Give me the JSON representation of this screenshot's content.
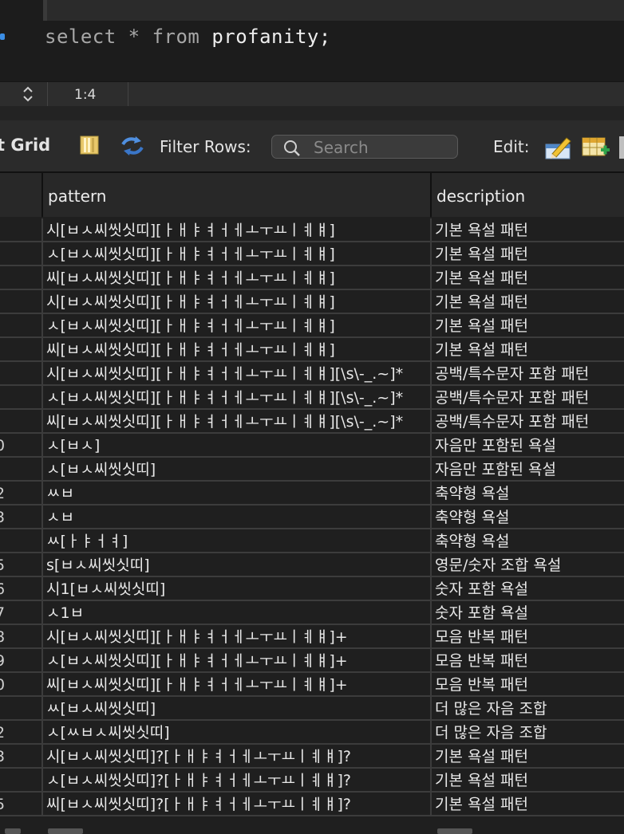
{
  "editor": {
    "query_keyword1": "select",
    "query_star": "*",
    "query_keyword2": "from",
    "query_table": "profanity;"
  },
  "statusbar": {
    "position": "1:4"
  },
  "toolbar": {
    "grid_label": "t Grid",
    "filter_label": "Filter Rows:",
    "search_placeholder": "Search",
    "edit_label": "Edit:"
  },
  "grid": {
    "columns": [
      "pattern",
      "description"
    ],
    "rows": [
      {
        "id": "",
        "pattern": "시[ㅂㅅ씨씻싯띠][ㅏㅐㅑㅕㅓㅔㅗㅜㅛㅣㅖㅒ]",
        "description": "기본 욕설 패턴"
      },
      {
        "id": "",
        "pattern": "ㅅ[ㅂㅅ씨씻싯띠][ㅏㅐㅑㅕㅓㅔㅗㅜㅛㅣㅖㅒ]",
        "description": "기본 욕설 패턴"
      },
      {
        "id": "",
        "pattern": "씨[ㅂㅅ씨씻싯띠][ㅏㅐㅑㅕㅓㅔㅗㅜㅛㅣㅖㅒ]",
        "description": "기본 욕설 패턴"
      },
      {
        "id": "",
        "pattern": "시[ㅂㅅ씨씻싯띠][ㅏㅐㅑㅕㅓㅔㅗㅜㅛㅣㅖㅒ]",
        "description": "기본 욕설 패턴"
      },
      {
        "id": "",
        "pattern": "ㅅ[ㅂㅅ씨씻싯띠][ㅏㅐㅑㅕㅓㅔㅗㅜㅛㅣㅖㅒ]",
        "description": "기본 욕설 패턴"
      },
      {
        "id": "",
        "pattern": "씨[ㅂㅅ씨씻싯띠][ㅏㅐㅑㅕㅓㅔㅗㅜㅛㅣㅖㅒ]",
        "description": "기본 욕설 패턴"
      },
      {
        "id": "",
        "pattern": "시[ㅂㅅ씨씻싯띠][ㅏㅐㅑㅕㅓㅔㅗㅜㅛㅣㅖㅒ][\\s\\-_.~]*",
        "description": "공백/특수문자 포함 패턴"
      },
      {
        "id": "",
        "pattern": "ㅅ[ㅂㅅ씨씻싯띠][ㅏㅐㅑㅕㅓㅔㅗㅜㅛㅣㅖㅒ][\\s\\-_.~]*",
        "description": "공백/특수문자 포함 패턴"
      },
      {
        "id": "",
        "pattern": "씨[ㅂㅅ씨씻싯띠][ㅏㅐㅑㅕㅓㅔㅗㅜㅛㅣㅖㅒ][\\s\\-_.~]*",
        "description": "공백/특수문자 포함 패턴"
      },
      {
        "id": "0",
        "pattern": "ㅅ[ㅂㅅ]",
        "description": "자음만 포함된 욕설"
      },
      {
        "id": "",
        "pattern": "ㅅ[ㅂㅅ씨씻싯띠]",
        "description": "자음만 포함된 욕설"
      },
      {
        "id": "2",
        "pattern": "ㅆㅂ",
        "description": "축약형 욕설"
      },
      {
        "id": "3",
        "pattern": "ㅅㅂ",
        "description": "축약형 욕설"
      },
      {
        "id": "",
        "pattern": "ㅆ[ㅏㅑㅓㅕ]",
        "description": "축약형 욕설"
      },
      {
        "id": "5",
        "pattern": "s[ㅂㅅ씨씻싯띠]",
        "description": "영문/숫자 조합 욕설"
      },
      {
        "id": "6",
        "pattern": "시1[ㅂㅅ씨씻싯띠]",
        "description": "숫자 포함 욕설"
      },
      {
        "id": "7",
        "pattern": "ㅅ1ㅂ",
        "description": "숫자 포함 욕설"
      },
      {
        "id": "8",
        "pattern": "시[ㅂㅅ씨씻싯띠][ㅏㅐㅑㅕㅓㅔㅗㅜㅛㅣㅖㅒ]+",
        "description": "모음 반복 패턴"
      },
      {
        "id": "9",
        "pattern": "ㅅ[ㅂㅅ씨씻싯띠][ㅏㅐㅑㅕㅓㅔㅗㅜㅛㅣㅖㅒ]+",
        "description": "모음 반복 패턴"
      },
      {
        "id": "0",
        "pattern": "씨[ㅂㅅ씨씻싯띠][ㅏㅐㅑㅕㅓㅔㅗㅜㅛㅣㅖㅒ]+",
        "description": "모음 반복 패턴"
      },
      {
        "id": "",
        "pattern": "ㅆ[ㅂㅅ씨씻싯띠]",
        "description": "더 많은 자음 조합"
      },
      {
        "id": "2",
        "pattern": "ㅅ[ㅆㅂㅅ씨씻싯띠]",
        "description": "더 많은 자음 조합"
      },
      {
        "id": "3",
        "pattern": "시[ㅂㅅ씨씻싯띠]?[ㅏㅐㅑㅕㅓㅔㅗㅜㅛㅣㅖㅒ]?",
        "description": "기본 욕설 패턴"
      },
      {
        "id": "",
        "pattern": "ㅅ[ㅂㅅ씨씻싯띠]?[ㅏㅐㅑㅕㅓㅔㅗㅜㅛㅣㅖㅒ]?",
        "description": "기본 욕설 패턴"
      },
      {
        "id": "5",
        "pattern": "씨[ㅂㅅ씨씻싯띠]?[ㅏㅐㅑㅕㅓㅔㅗㅜㅛㅣㅖㅒ]?",
        "description": "기본 욕설 패턴"
      }
    ]
  },
  "colors": {
    "accent_blue": "#3b8ee6"
  }
}
